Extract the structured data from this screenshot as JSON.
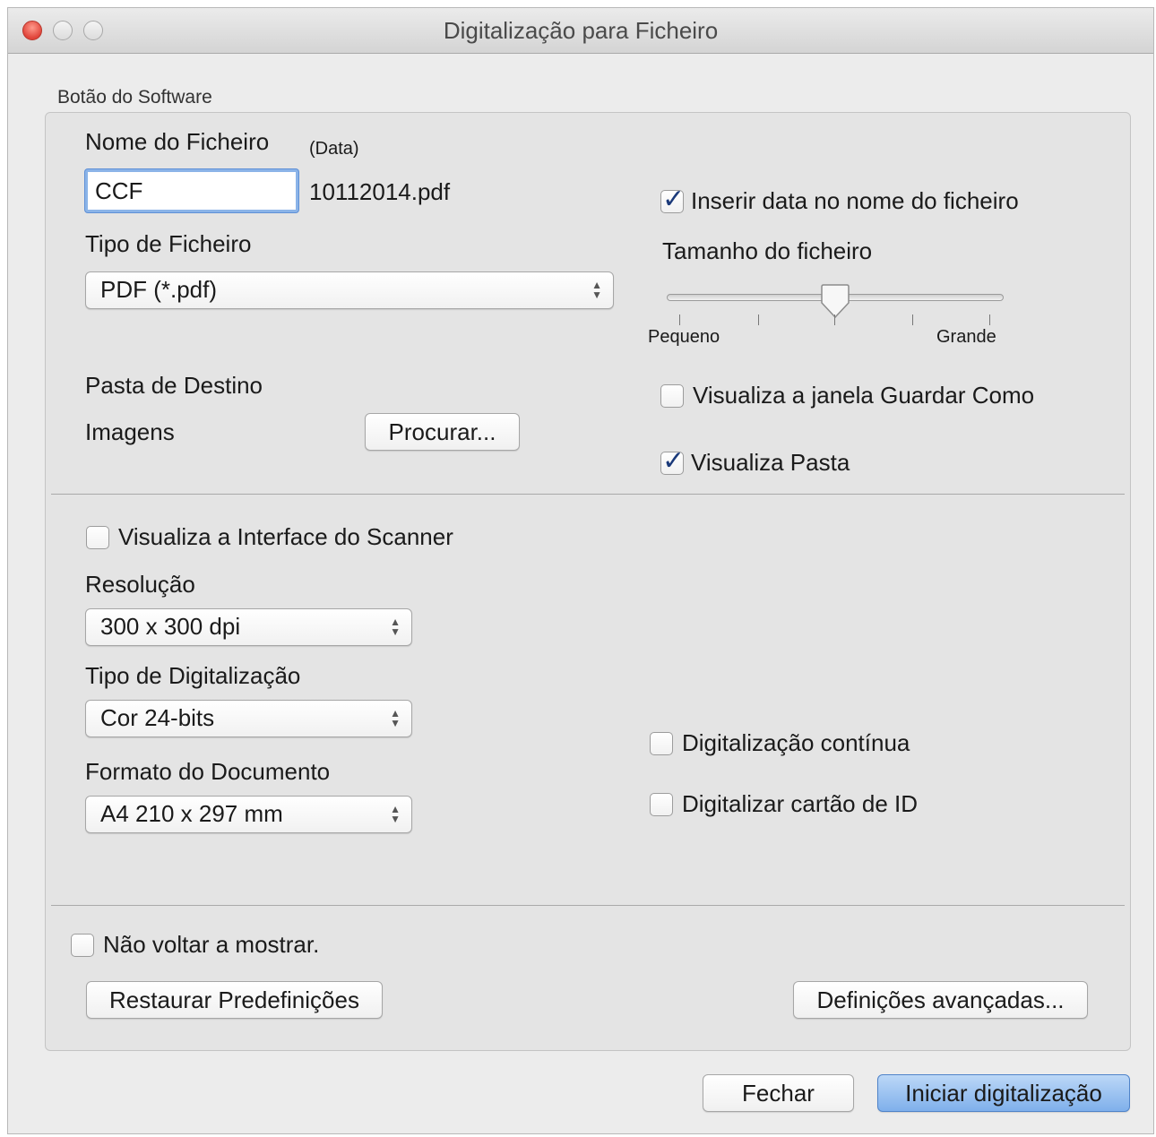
{
  "window": {
    "title": "Digitalização para Ficheiro"
  },
  "group": {
    "label": "Botão do Software"
  },
  "file": {
    "name_label": "Nome do Ficheiro",
    "date_label": "(Data)",
    "name_value": "CCF",
    "date_value": "10112014.pdf",
    "type_label": "Tipo de Ficheiro",
    "type_value": "PDF (*.pdf)",
    "insert_date": {
      "label": "Inserir data no nome do ficheiro",
      "checked": true
    },
    "size_label": "Tamanho do ficheiro",
    "size_level": 0.5,
    "size_min_label": "Pequeno",
    "size_max_label": "Grande"
  },
  "destination": {
    "label": "Pasta de Destino",
    "folder": "Imagens",
    "browse_label": "Procurar...",
    "show_save_as": {
      "label": "Visualiza a janela Guardar Como",
      "checked": false
    },
    "show_folder": {
      "label": "Visualiza Pasta",
      "checked": true
    }
  },
  "scan": {
    "show_interface": {
      "label": "Visualiza a Interface do Scanner",
      "checked": false
    },
    "resolution_label": "Resolução",
    "resolution_value": "300 x 300 dpi",
    "scan_type_label": "Tipo de Digitalização",
    "scan_type_value": "Cor 24-bits",
    "doc_size_label": "Formato do Documento",
    "doc_size_value": "A4 210 x 297 mm",
    "continuous": {
      "label": "Digitalização contínua",
      "checked": false
    },
    "id_card": {
      "label": "Digitalizar cartão de ID",
      "checked": false
    }
  },
  "footer": {
    "dont_show": {
      "label": "Não voltar a mostrar.",
      "checked": false
    },
    "restore_label": "Restaurar Predefinições",
    "advanced_label": "Definições avançadas...",
    "close_label": "Fechar",
    "start_label": "Iniciar digitalização"
  },
  "colors": {
    "accent": "#7fb0eb",
    "checkmark": "#1b3a7a",
    "close_dot": "#e0443a"
  }
}
